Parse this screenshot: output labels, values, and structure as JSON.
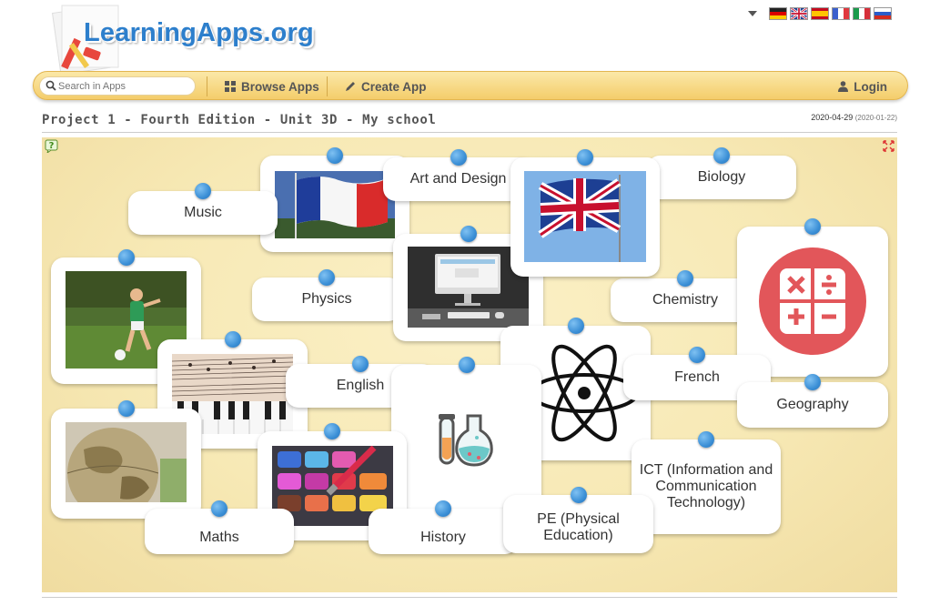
{
  "header": {
    "logo_text": "LearningApps.org",
    "languages": [
      "de",
      "en",
      "es",
      "fr",
      "it",
      "ru"
    ]
  },
  "nav": {
    "search_placeholder": "Search in Apps",
    "browse_label": "Browse Apps",
    "create_label": "Create App",
    "login_label": "Login"
  },
  "page": {
    "title": "Project 1 - Fourth Edition - Unit 3D - My school",
    "date": "2020-04-29",
    "date_created": "(2020-01-22)"
  },
  "board": {
    "cards": {
      "music": "Music",
      "art": "Art and Design",
      "biology": "Biology",
      "physics": "Physics",
      "chemistry": "Chemistry",
      "english": "English",
      "french": "French",
      "geography": "Geography",
      "ict": "ICT (Information and Communication Technology)",
      "maths": "Maths",
      "history": "History",
      "pe": "PE (Physical Education)"
    },
    "image_cards": [
      "french-flag",
      "computer",
      "uk-flag",
      "calculator",
      "football-player",
      "piano-sheet-music",
      "globe",
      "atom",
      "paint-palette",
      "chemistry-flasks"
    ]
  },
  "colors": {
    "logo_blue": "#2d7fcc",
    "navbar": "#f4cd6b",
    "pin_blue": "#3b8fd6",
    "board": "#f7e9b5"
  }
}
